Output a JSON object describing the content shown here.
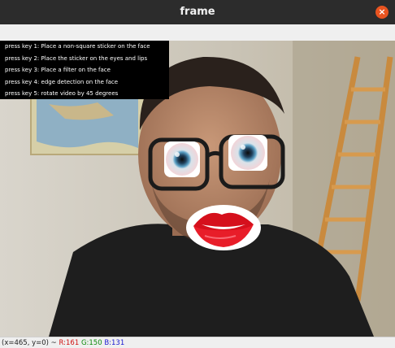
{
  "window": {
    "title": "frame",
    "close_glyph": "×"
  },
  "overlay": {
    "lines": [
      "press key 1: Place a non-square sticker on the face",
      "press key 2: Place the sticker on the eyes and lips",
      "press key 3: Place a filter on the face",
      "press key 4: edge detection on the face",
      "press key 5: rotate video by 45 degrees"
    ]
  },
  "status": {
    "coords": "(x=465, y=0) ~",
    "r": "R:161",
    "g": "G:150",
    "b": "B:131"
  },
  "colors": {
    "titlebar": "#2c2c2c",
    "close_button": "#e95420",
    "overlay_bg": "#000000",
    "status_r": "#d01010",
    "status_g": "#0a8a0a",
    "status_b": "#1a1ad0"
  }
}
